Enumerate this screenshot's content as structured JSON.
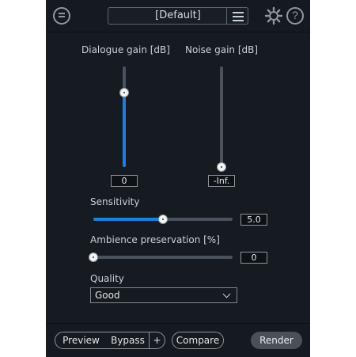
{
  "header": {
    "preset_value": "[Default]",
    "help_glyph": "?"
  },
  "dialogue": {
    "label": "Dialogue gain [dB]",
    "value": "0",
    "position_fraction": 0.74
  },
  "noise": {
    "label": "Noise gain [dB]",
    "value": "-Inf.",
    "position_fraction": 0.0
  },
  "sensitivity": {
    "label": "Sensitivity",
    "value": "5.0",
    "fraction": 0.5
  },
  "ambience": {
    "label": "Ambience preservation [%]",
    "value": "0",
    "fraction": 0.0
  },
  "quality": {
    "label": "Quality",
    "selected": "Good"
  },
  "footer": {
    "preview": "Preview",
    "bypass": "Bypass",
    "plus": "+",
    "compare": "Compare",
    "render": "Render"
  },
  "colors": {
    "accent": "#1a7fe5",
    "panel": "#151b21",
    "track": "#4a535d"
  },
  "icons": {
    "chat": "chat-bubble-icon",
    "gear": "gear-icon",
    "help": "help-icon",
    "menu": "hamburger-menu-icon",
    "dropdown": "chevron-down-icon"
  }
}
